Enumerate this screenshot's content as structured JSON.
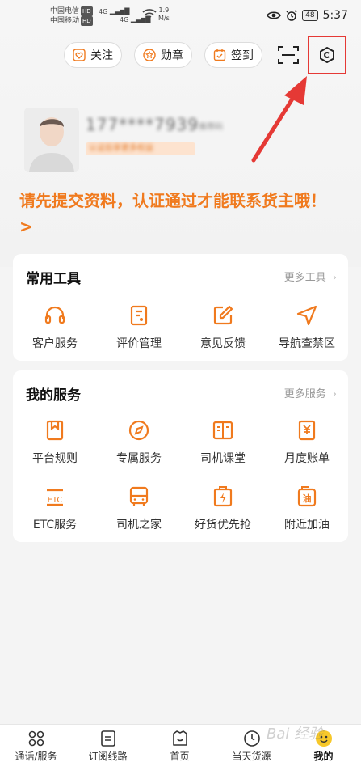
{
  "status_bar": {
    "carrier1": "中国电信",
    "carrier2": "中国移动",
    "hd": "HD",
    "network1": "4G",
    "network2": "4G",
    "speed_value": "1.9",
    "speed_unit": "M/s",
    "battery": "48",
    "time": "5:37"
  },
  "header": {
    "follow_label": "关注",
    "medal_label": "勋章",
    "checkin_label": "签到"
  },
  "profile": {
    "phone": "177****7939",
    "phone_tag": "推荐码",
    "cert_tip": "认证后享更多权益"
  },
  "notice": "请先提交资料，认证通过才能联系货主哦！ >",
  "tools_card": {
    "title": "常用工具",
    "more": "更多工具",
    "items": [
      {
        "label": "客户服务",
        "icon": "headset-icon"
      },
      {
        "label": "评价管理",
        "icon": "review-icon"
      },
      {
        "label": "意见反馈",
        "icon": "edit-icon"
      },
      {
        "label": "导航查禁区",
        "icon": "navigation-icon"
      }
    ]
  },
  "services_card": {
    "title": "我的服务",
    "more": "更多服务",
    "items": [
      {
        "label": "平台规则",
        "icon": "bookmark-icon"
      },
      {
        "label": "专属服务",
        "icon": "compass-icon"
      },
      {
        "label": "司机课堂",
        "icon": "book-icon"
      },
      {
        "label": "月度账单",
        "icon": "bill-icon"
      },
      {
        "label": "ETC服务",
        "icon": "etc-icon",
        "icon_text": "ETC"
      },
      {
        "label": "司机之家",
        "icon": "truck-icon"
      },
      {
        "label": "好货优先抢",
        "icon": "lightning-box-icon"
      },
      {
        "label": "附近加油",
        "icon": "fuel-icon",
        "icon_text": "油"
      }
    ]
  },
  "bottom_nav": {
    "items": [
      {
        "label": "通话/服务"
      },
      {
        "label": "订阅线路"
      },
      {
        "label": "首页"
      },
      {
        "label": "当天货源"
      },
      {
        "label": "我的"
      }
    ]
  },
  "watermark": "Bai 经验",
  "colors": {
    "accent": "#f07a1e",
    "highlight": "#e53935"
  }
}
